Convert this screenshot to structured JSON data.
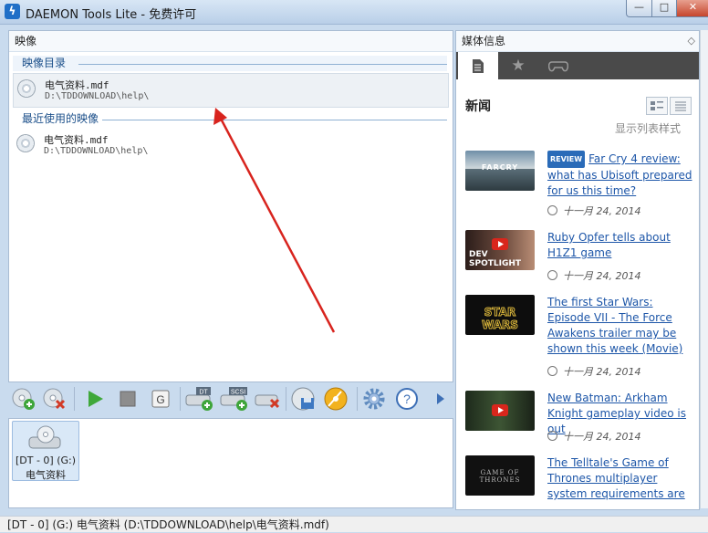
{
  "window": {
    "title": "DAEMON Tools Lite - 免费许可",
    "minimize": "—",
    "maximize": "□",
    "close": "✕"
  },
  "images_panel": {
    "header": "映像",
    "catalog_group": "映像目录",
    "recent_group": "最近使用的映像",
    "catalog_items": [
      {
        "name": "电气资料.mdf",
        "path": "D:\\TDDOWNLOAD\\help\\"
      }
    ],
    "recent_items": [
      {
        "name": "电气资料.mdf",
        "path": "D:\\TDDOWNLOAD\\help\\"
      }
    ]
  },
  "toolbar": {
    "icons": [
      "add-image-icon",
      "remove-image-icon",
      "play-icon",
      "stop-icon",
      "g-icon",
      "add-dt-drive-icon",
      "add-scsi-drive-icon",
      "remove-drive-icon",
      "write-image-icon",
      "burn-icon",
      "settings-icon",
      "help-icon",
      "more-arrow-icon"
    ],
    "dt_tag": "DT",
    "scsi_tag": "SCSI",
    "g_label": "G",
    "help_label": "?"
  },
  "drives": [
    {
      "label": "[DT - 0] (G:)",
      "image": "电气资料"
    }
  ],
  "media_panel": {
    "header": "媒体信息",
    "news_title": "新闻",
    "list_style_link": "显示列表样式",
    "news": [
      {
        "badge": "REVIEW",
        "title": "Far Cry 4 review: what has Ubisoft prepared for us this time?",
        "date": "十一月 24, 2014",
        "thumb_caption": "FARCRY"
      },
      {
        "badge": "",
        "title": "Ruby Opfer tells about H1Z1 game",
        "date": "十一月 24, 2014",
        "thumb_caption": "DEV SPOTLIGHT"
      },
      {
        "badge": "",
        "title": "The first Star Wars: Episode VII - The Force Awakens trailer may be shown this week (Movie)",
        "date": "十一月 24, 2014",
        "thumb_caption": "STAR WARS"
      },
      {
        "badge": "",
        "title": "New Batman: Arkham Knight gameplay video is out",
        "date": "十一月 24, 2014",
        "thumb_caption": ""
      },
      {
        "badge": "",
        "title": "The Telltale's Game of Thrones multiplayer system requirements are",
        "date": "",
        "thumb_caption": "GAME OF THRONES"
      }
    ],
    "colors": {
      "link": "#1d56a8",
      "tabbar": "#4a4a4a",
      "badge": "#2a6bb8"
    }
  },
  "status": {
    "text": "[DT - 0] (G:) 电气资料 (D:\\TDDOWNLOAD\\help\\电气资料.mdf)"
  },
  "annotation": {
    "arrow_color": "#d8241e"
  }
}
